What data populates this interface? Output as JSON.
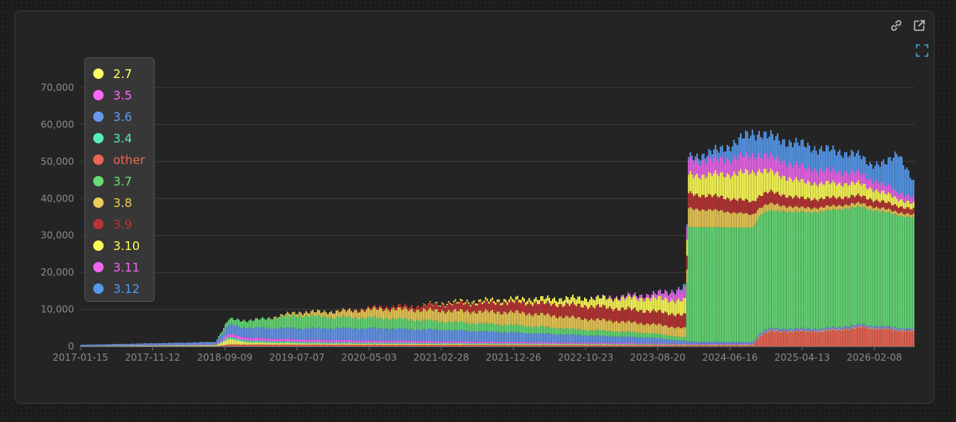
{
  "toolbar": {
    "link_icon": "link-icon",
    "open_icon": "external-link-icon",
    "fullscreen_icon": "expand-icon"
  },
  "chart_data": {
    "type": "bar",
    "stacked": true,
    "grid": "horizontal",
    "legend_position": "top-left",
    "ylim": [
      0,
      70000
    ],
    "y_ticks": [
      "0",
      "10,000",
      "20,000",
      "30,000",
      "40,000",
      "50,000",
      "60,000",
      "70,000"
    ],
    "x_ticks": [
      "2017-01-15",
      "2017-11-12",
      "2018-09-09",
      "2019-07-07",
      "2020-05-03",
      "2021-02-28",
      "2021-12-26",
      "2022-10-23",
      "2023-08-20",
      "2024-06-16",
      "2025-04-13",
      "2026-02-08"
    ],
    "x_tick_index": [
      0,
      43,
      86,
      129,
      172,
      215,
      258,
      301,
      344,
      387,
      430,
      473
    ],
    "legend": [
      "2.7",
      "3.5",
      "3.6",
      "3.4",
      "other",
      "3.7",
      "3.8",
      "3.9",
      "3.10",
      "3.11",
      "3.12"
    ],
    "stack_order": [
      "other",
      "2.7",
      "3.4",
      "3.5",
      "3.6",
      "3.7",
      "3.8",
      "3.9",
      "3.10",
      "3.11",
      "3.12"
    ],
    "colors": {
      "2.7": "#ffff66",
      "3.5": "#ff66ff",
      "3.6": "#6699ee",
      "3.4": "#55eebb",
      "other": "#ee6655",
      "3.7": "#66dd77",
      "3.8": "#eecc55",
      "3.9": "#bb3333",
      "3.10": "#ffff55",
      "3.11": "#ee66ee",
      "3.12": "#5599ee"
    },
    "n_bars": 497,
    "series": [
      {
        "name": "other",
        "x": [
          0,
          80,
          88,
          362,
          400,
          405,
          410,
          440,
          460,
          465,
          475,
          496
        ],
        "y": [
          0,
          0,
          500,
          300,
          300,
          3000,
          4000,
          4000,
          4800,
          5200,
          4700,
          4000
        ]
      },
      {
        "name": "2.7",
        "x": [
          0,
          80,
          88,
          100,
          140,
          200,
          260,
          340,
          362,
          496
        ],
        "y": [
          50,
          200,
          1500,
          600,
          300,
          250,
          200,
          150,
          100,
          100
        ]
      },
      {
        "name": "3.4",
        "x": [
          0,
          80,
          88,
          120,
          160,
          220,
          362,
          496
        ],
        "y": [
          30,
          200,
          500,
          400,
          300,
          250,
          100,
          100
        ]
      },
      {
        "name": "3.5",
        "x": [
          0,
          80,
          88,
          120,
          160,
          220,
          300,
          362,
          496
        ],
        "y": [
          40,
          200,
          800,
          700,
          600,
          500,
          300,
          200,
          200
        ]
      },
      {
        "name": "3.6",
        "x": [
          0,
          80,
          88,
          110,
          130,
          150,
          180,
          220,
          260,
          300,
          340,
          362,
          400,
          496
        ],
        "y": [
          300,
          600,
          2500,
          2800,
          3000,
          3200,
          3300,
          3000,
          2500,
          2000,
          1500,
          600,
          400,
          300
        ]
      },
      {
        "name": "3.7",
        "x": [
          0,
          80,
          88,
          110,
          130,
          150,
          180,
          220,
          260,
          300,
          340,
          360,
          362,
          400,
          405,
          430,
          460,
          496
        ],
        "y": [
          0,
          0,
          1500,
          2500,
          3500,
          3000,
          2800,
          2200,
          2000,
          1500,
          1200,
          1000,
          31000,
          31000,
          32000,
          31500,
          32000,
          30000
        ]
      },
      {
        "name": "3.8",
        "x": [
          0,
          110,
          120,
          150,
          180,
          220,
          260,
          300,
          340,
          360,
          362,
          380,
          400,
          405,
          430,
          496
        ],
        "y": [
          0,
          0,
          500,
          1500,
          2500,
          3000,
          3500,
          3000,
          2500,
          2500,
          5000,
          4500,
          3500,
          2000,
          1200,
          800
        ]
      },
      {
        "name": "3.9",
        "x": [
          0,
          150,
          160,
          200,
          220,
          260,
          300,
          340,
          360,
          362,
          400,
          430,
          496
        ],
        "y": [
          0,
          0,
          200,
          1000,
          2000,
          2800,
          3500,
          3500,
          3500,
          4000,
          3500,
          2500,
          1500
        ]
      },
      {
        "name": "3.10",
        "x": [
          0,
          200,
          210,
          260,
          300,
          340,
          360,
          362,
          380,
          400,
          410,
          430,
          460,
          496
        ],
        "y": [
          0,
          0,
          200,
          800,
          2000,
          3500,
          4000,
          5000,
          6000,
          8000,
          5500,
          4500,
          3500,
          1500
        ]
      },
      {
        "name": "3.11",
        "x": [
          0,
          300,
          310,
          340,
          360,
          362,
          380,
          400,
          410,
          430,
          460,
          496
        ],
        "y": [
          0,
          0,
          100,
          1000,
          3000,
          4000,
          4000,
          4500,
          4000,
          4000,
          3000,
          1500
        ]
      },
      {
        "name": "3.12",
        "x": [
          0,
          340,
          350,
          362,
          380,
          400,
          410,
          430,
          460,
          470,
          480,
          487,
          496
        ],
        "y": [
          0,
          0,
          100,
          700,
          2500,
          6000,
          5500,
          6000,
          5000,
          4000,
          6000,
          11000,
          4000
        ]
      }
    ]
  }
}
